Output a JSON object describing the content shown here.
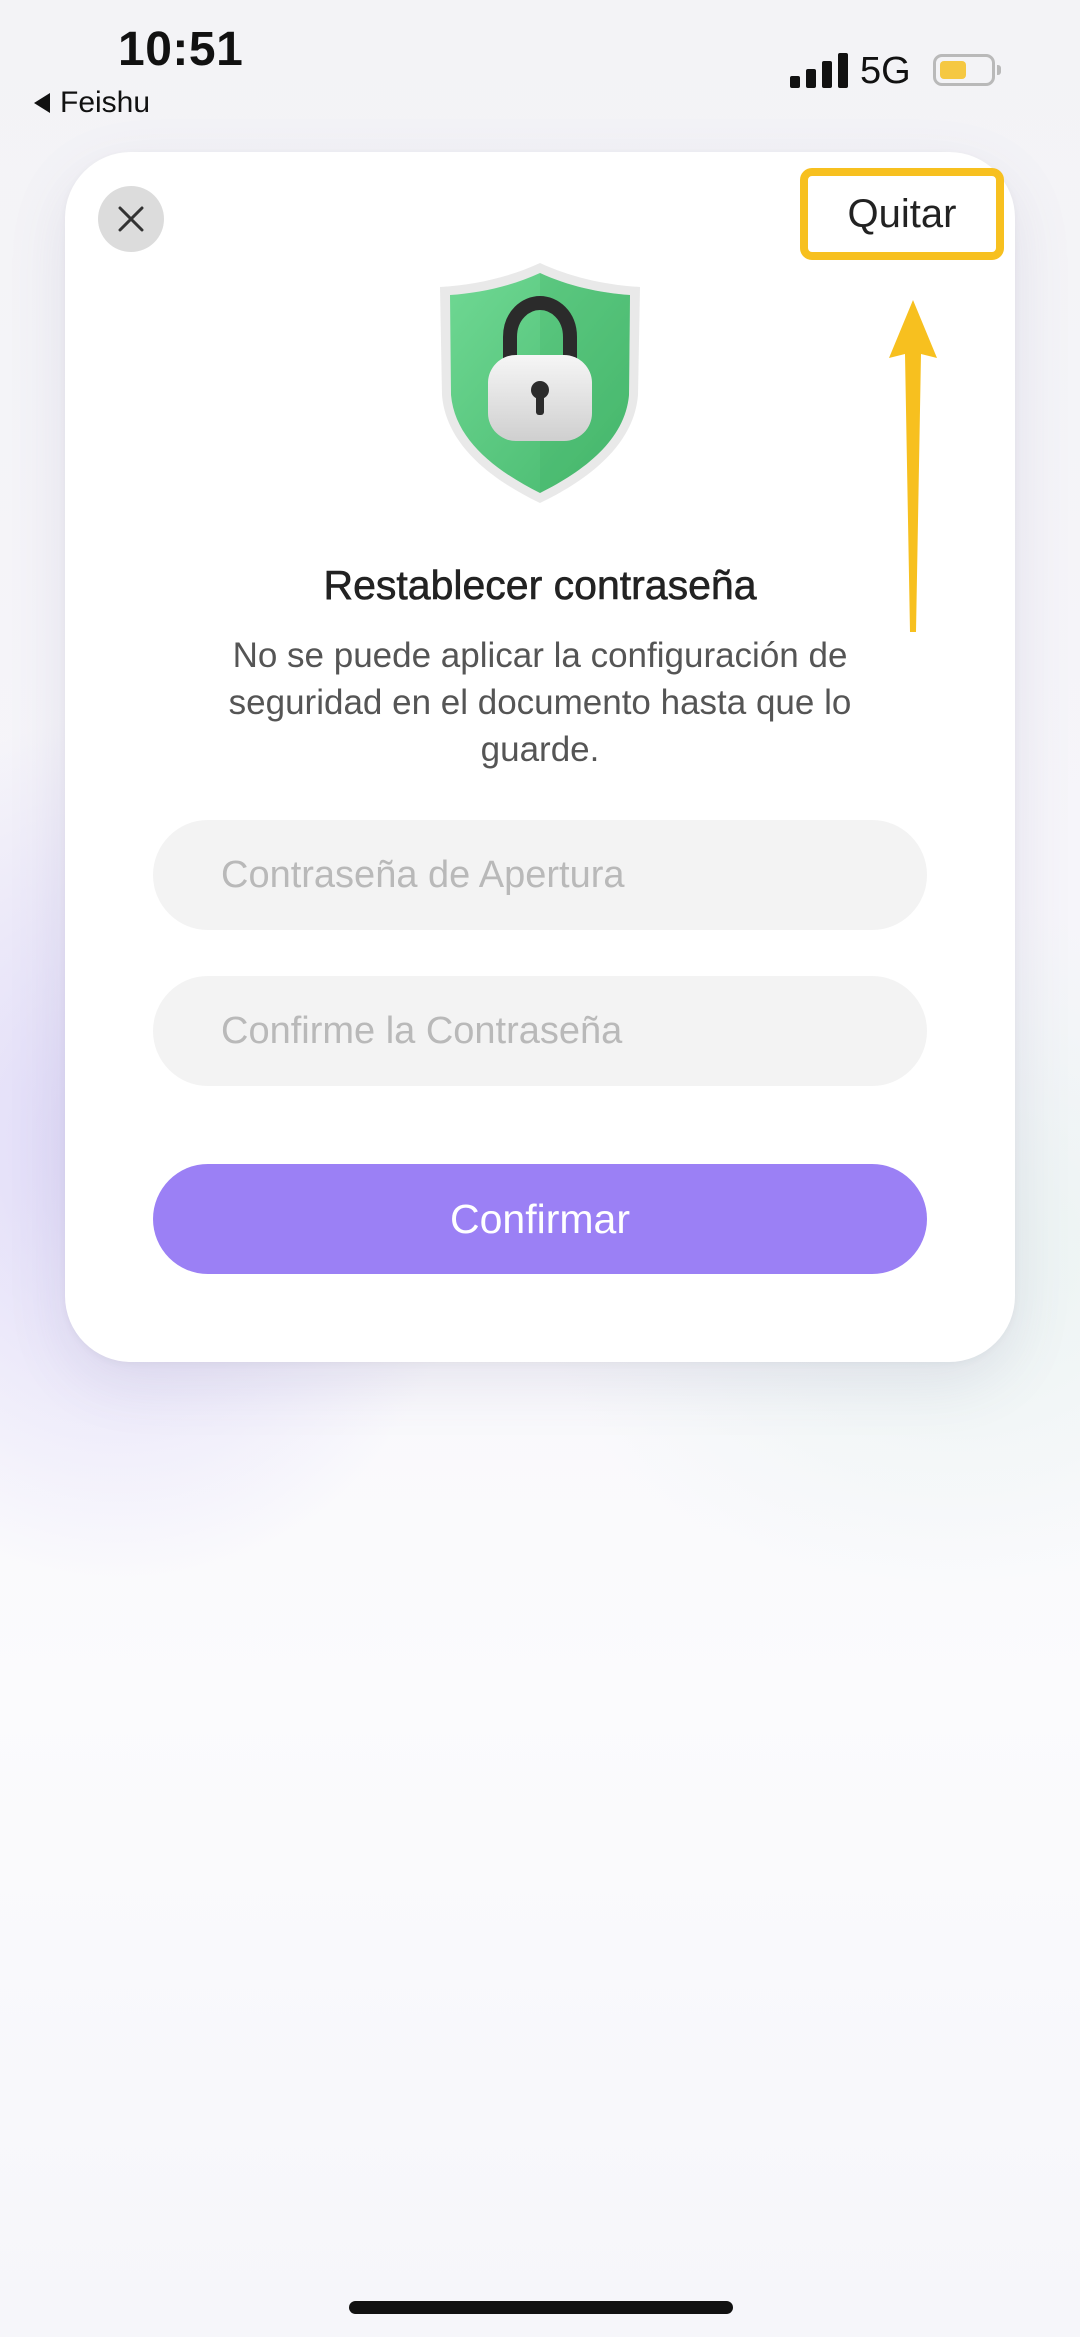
{
  "status_bar": {
    "time": "10:51",
    "back_app": "Feishu",
    "network": "5G",
    "battery_color": "#f5c842"
  },
  "dialog": {
    "title": "Restablecer contraseña",
    "description": "No se puede aplicar la configuración de seguridad en el documento hasta que lo guarde.",
    "quit_label": "Quitar",
    "password_placeholder": "Contraseña de Apertura",
    "confirm_password_placeholder": "Confirme la Contraseña",
    "confirm_label": "Confirmar",
    "icons": {
      "close": "close-icon",
      "shield": "shield-lock-icon",
      "annotation_arrow": "arrow-up-icon"
    }
  },
  "colors": {
    "accent": "#9b80f5",
    "highlight": "#f7c01f",
    "shield_green": "#5fcd86"
  }
}
